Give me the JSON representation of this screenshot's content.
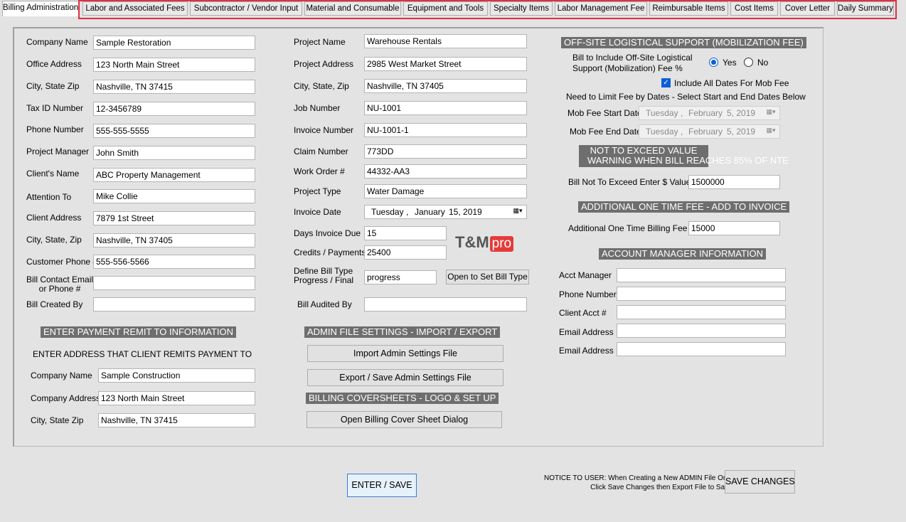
{
  "tabs": [
    "Billing Administration",
    "Labor and Associated Fees",
    "Subcontractor / Vendor Input",
    "Material and Consumable",
    "Equipment and Tools",
    "Specialty Items",
    "Labor Management Fee",
    "Reimbursable Items",
    "Cost Items",
    "Cover Letter",
    "Daily Summary"
  ],
  "left": {
    "company_name": {
      "label": "Company Name",
      "value": "Sample Restoration"
    },
    "office_address": {
      "label": "Office Address",
      "value": "123 North Main Street"
    },
    "city_state_zip": {
      "label": "City, State  Zip",
      "value": "Nashville, TN 37415"
    },
    "tax_id": {
      "label": "Tax ID Number",
      "value": "12-3456789"
    },
    "phone": {
      "label": "Phone Number",
      "value": "555-555-5555"
    },
    "project_manager": {
      "label": "Project Manager",
      "value": "John Smith"
    },
    "client_name": {
      "label": "Client's Name",
      "value": "ABC Property Management"
    },
    "attention_to": {
      "label": "Attention To",
      "value": "Mike Collie"
    },
    "client_address": {
      "label": "Client Address",
      "value": "7879 1st Street"
    },
    "client_city": {
      "label": "City, State, Zip",
      "value": "Nashville, TN 37405"
    },
    "customer_phone": {
      "label": "Customer Phone #",
      "value": "555-556-5566"
    },
    "bill_contact": {
      "label1": "Bill Contact Email",
      "label2": "or Phone #",
      "value": ""
    },
    "bill_created_by": {
      "label": "Bill Created By",
      "value": ""
    }
  },
  "remit": {
    "header": "ENTER PAYMENT REMIT TO INFORMATION",
    "subheader": "ENTER ADDRESS THAT CLIENT REMITS PAYMENT TO",
    "company_name": {
      "label": "Company Name",
      "value": "Sample Construction"
    },
    "company_address": {
      "label": "Company Address",
      "value": "123 North Main Street"
    },
    "city_state_zip": {
      "label": "City, State  Zip",
      "value": "Nashville, TN 37415"
    }
  },
  "middle": {
    "project_name": {
      "label": "Project Name",
      "value": "Warehouse Rentals"
    },
    "project_address": {
      "label": "Project Address",
      "value": "2985 West Market Street"
    },
    "city_state_zip": {
      "label": "City, State, Zip",
      "value": "Nashville, TN 37405"
    },
    "job_number": {
      "label": "Job Number",
      "value": "NU-1001"
    },
    "invoice_number": {
      "label": "Invoice Number",
      "value": "NU-1001-1"
    },
    "claim_number": {
      "label": "Claim Number",
      "value": "773DD"
    },
    "work_order": {
      "label": "Work Order #",
      "value": "44332-AA3"
    },
    "project_type": {
      "label": "Project Type",
      "value": "Water Damage"
    },
    "invoice_date": {
      "label": "Invoice Date",
      "day": "Tuesday",
      "comma1": ",",
      "month": "January",
      "date": "15, 2019"
    },
    "days_due": {
      "label": "Days Invoice Due",
      "value": "15"
    },
    "credits": {
      "label": "Credits / Payments",
      "value": "25400"
    },
    "bill_type": {
      "label1": "Define Bill Type",
      "label2": "Progress / Final",
      "value": "progress",
      "button": "Open to Set Bill Type"
    },
    "bill_audited": {
      "label": "Bill Audited By",
      "value": ""
    },
    "logo": {
      "text": "T&M",
      "pro": "pro"
    }
  },
  "admin": {
    "header": "ADMIN FILE SETTINGS - IMPORT / EXPORT",
    "import_btn": "Import Admin Settings File",
    "export_btn": "Export / Save Admin Settings File",
    "cover_header": "BILLING COVERSHEETS - LOGO & SET UP",
    "cover_btn": "Open Billing Cover Sheet Dialog"
  },
  "right": {
    "mob_header": "OFF-SITE LOGISTICAL SUPPORT (MOBILIZATION FEE)",
    "mob_q1": "Bill to Include Off-Site Logistical",
    "mob_q2": "Support (Mobilization) Fee %",
    "yes": "Yes",
    "no": "No",
    "include_all": "Include All Dates For Mob Fee",
    "limit_note": "Need to Limit Fee by Dates - Select Start and End Dates Below",
    "start_label": "Mob Fee Start Date",
    "end_label": "Mob Fee End Date",
    "start_date": {
      "day": "Tuesday",
      "month": "February",
      "date": "5, 2019"
    },
    "end_date": {
      "day": "Tuesday",
      "month": "February",
      "date": "5, 2019"
    },
    "nte_header1": "NOT TO EXCEED VALUE",
    "nte_header2": "WARNING WHEN BILL REACHES 85% OF NTE",
    "nte_label": "Bill Not To Exceed Enter $ Value",
    "nte_value": "1500000",
    "fee_header": "ADDITIONAL ONE TIME FEE - ADD TO INVOICE",
    "fee_label": "Additional One Time Billing Fee",
    "fee_value": "15000",
    "acct_header": "ACCOUNT MANAGER INFORMATION",
    "acct_manager": "Acct Manager",
    "acct_phone": "Phone Number",
    "client_acct": "Client Acct #",
    "email1": "Email Address",
    "email2": "Email Address"
  },
  "footer": {
    "enter_save": "ENTER / SAVE",
    "notice1": "NOTICE TO USER: When Creating a New ADMIN File Only",
    "notice2": "Click Save Changes then Export File to Save",
    "save_changes": "SAVE CHANGES"
  }
}
